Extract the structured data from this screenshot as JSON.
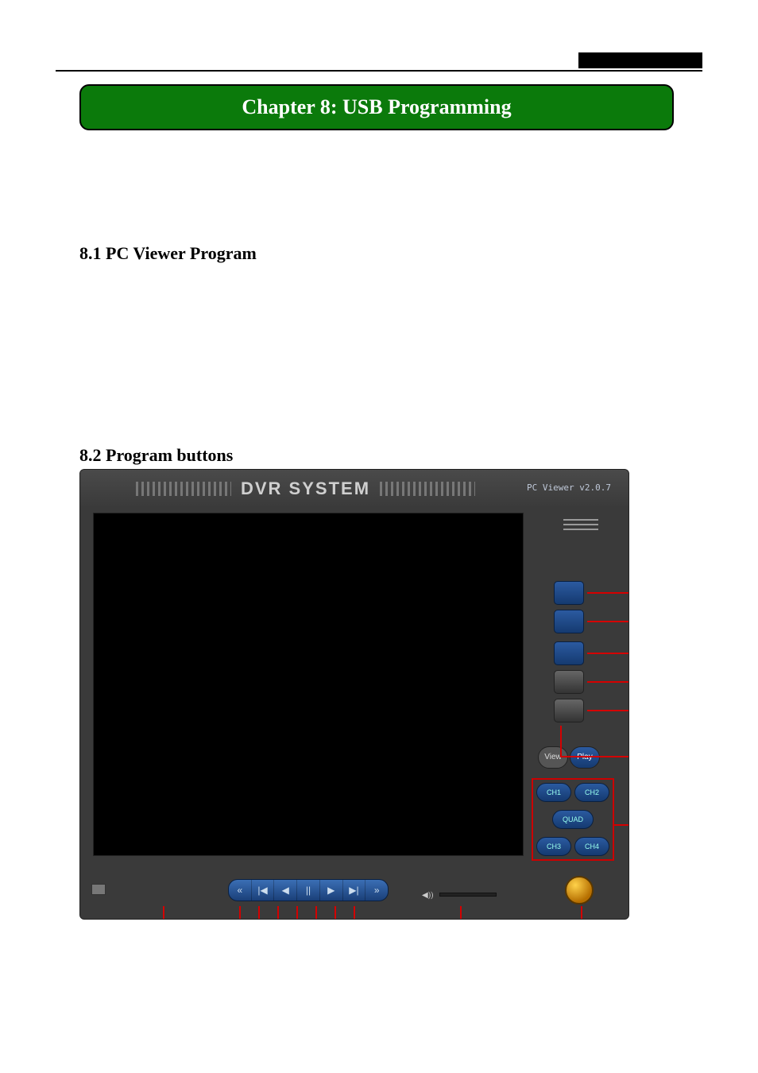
{
  "header": {
    "chapter_title": "Chapter 8: USB Programming"
  },
  "sections": {
    "s1": "8.1 PC Viewer Program",
    "s2": "8.2 Program buttons"
  },
  "app": {
    "title": "DVR SYSTEM",
    "version": "PC Viewer v2.0.7",
    "mode": {
      "view": "View",
      "play": "Play"
    },
    "channels": {
      "c1": "CH1",
      "c2": "CH2",
      "quad": "QUAD",
      "c3": "CH3",
      "c4": "CH4"
    },
    "transport": {
      "rew": "«",
      "prev": "|◀",
      "back": "◀",
      "pause": "||",
      "play": "▶",
      "next": "▶|",
      "ff": "»"
    },
    "volume_icon": "◀))",
    "side_buttons": {
      "s1": "connect-icon",
      "s2": "capture-icon",
      "s3": "record-icon",
      "s4": "settings-icon",
      "s5": "folder-icon"
    }
  }
}
